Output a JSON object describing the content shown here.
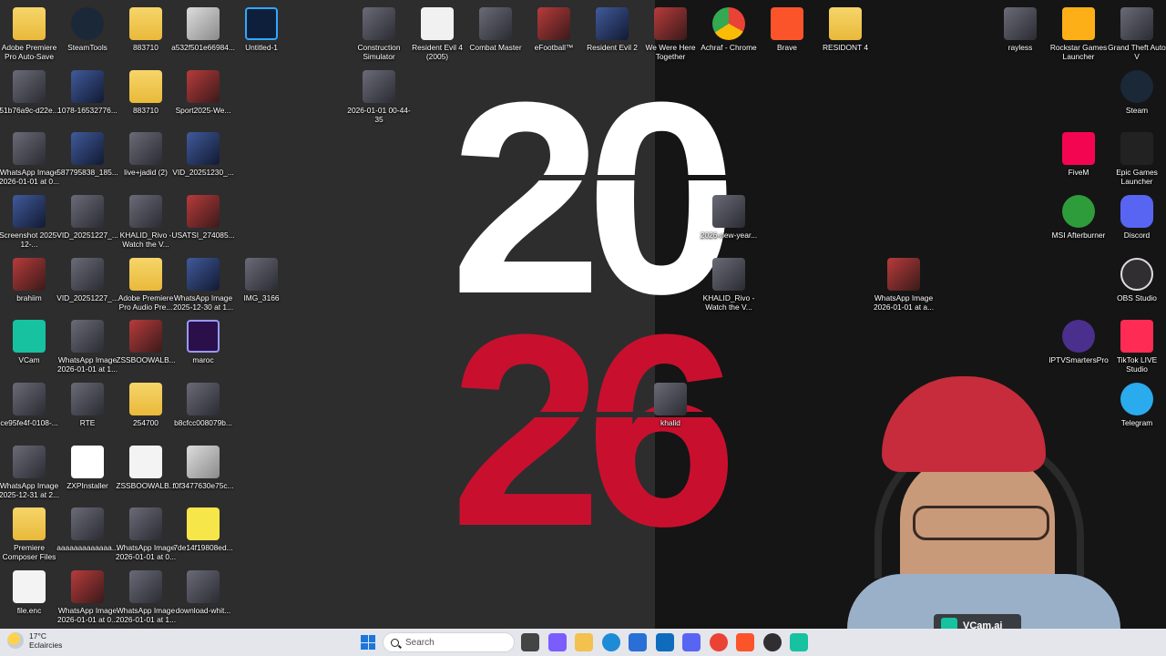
{
  "wallpaper": {
    "top": "20",
    "bottom": "26"
  },
  "desktop_icons": [
    {
      "id": "i1",
      "label": "Adobe Premiere Pro Auto-Save",
      "kind": "folder"
    },
    {
      "id": "i2",
      "label": "SteamTools",
      "kind": "steamtools"
    },
    {
      "id": "i3",
      "label": "883710",
      "kind": "folder"
    },
    {
      "id": "i4",
      "label": "a532f501e66984...",
      "kind": "thumb-light"
    },
    {
      "id": "i5",
      "label": "Untitled-1",
      "kind": "psd"
    },
    {
      "id": "i6",
      "label": "Construction Simulator",
      "kind": "thumb"
    },
    {
      "id": "i7",
      "label": "Resident Evil 4 (2005)",
      "kind": "re4"
    },
    {
      "id": "i8",
      "label": "Combat Master",
      "kind": "thumb"
    },
    {
      "id": "i9",
      "label": "eFootball™",
      "kind": "thumb-red"
    },
    {
      "id": "i10",
      "label": "Resident Evil 2",
      "kind": "thumb-blue"
    },
    {
      "id": "i11",
      "label": "We Were Here Together",
      "kind": "thumb-red"
    },
    {
      "id": "i12",
      "label": "Achraf - Chrome",
      "kind": "chrome"
    },
    {
      "id": "i13",
      "label": "Brave",
      "kind": "brave"
    },
    {
      "id": "i14",
      "label": "RESIDONT 4",
      "kind": "folder"
    },
    {
      "id": "i15",
      "label": "rayless",
      "kind": "thumb"
    },
    {
      "id": "i16",
      "label": "Rockstar Games Launcher",
      "kind": "rockstar"
    },
    {
      "id": "i17",
      "label": "Grand Theft Auto V",
      "kind": "thumb"
    },
    {
      "id": "i18",
      "label": "51b76a9c-d22e...",
      "kind": "thumb"
    },
    {
      "id": "i19",
      "label": "1078-16532776...",
      "kind": "thumb-blue"
    },
    {
      "id": "i20",
      "label": "883710",
      "kind": "folder"
    },
    {
      "id": "i21",
      "label": "Sport2025-We...",
      "kind": "thumb-red"
    },
    {
      "id": "i22",
      "label": "2026-01-01 00-44-35",
      "kind": "thumb"
    },
    {
      "id": "i23",
      "label": "Steam",
      "kind": "steam"
    },
    {
      "id": "i24",
      "label": "WhatsApp Image 2026-01-01 at 0...",
      "kind": "thumb"
    },
    {
      "id": "i25",
      "label": "587795838_185...",
      "kind": "thumb-blue"
    },
    {
      "id": "i26",
      "label": "live+jadid (2)",
      "kind": "thumb"
    },
    {
      "id": "i27",
      "label": "VID_20251230_...",
      "kind": "thumb-blue"
    },
    {
      "id": "i28",
      "label": "FiveM",
      "kind": "fivem"
    },
    {
      "id": "i29",
      "label": "Epic Games Launcher",
      "kind": "epic"
    },
    {
      "id": "i30",
      "label": "Screenshot 2025-12-...",
      "kind": "thumb-blue"
    },
    {
      "id": "i31",
      "label": "VID_20251227_...",
      "kind": "thumb"
    },
    {
      "id": "i32",
      "label": "KHALID_Rivo - Watch the V...",
      "kind": "thumb"
    },
    {
      "id": "i33",
      "label": "USATSI_274085...",
      "kind": "thumb-red"
    },
    {
      "id": "i34",
      "label": "2026-new-year...",
      "kind": "thumb"
    },
    {
      "id": "i35",
      "label": "MSI Afterburner",
      "kind": "msi"
    },
    {
      "id": "i36",
      "label": "Discord",
      "kind": "discord"
    },
    {
      "id": "i37",
      "label": "brahiim",
      "kind": "thumb-red"
    },
    {
      "id": "i38",
      "label": "VID_20251227_...",
      "kind": "thumb"
    },
    {
      "id": "i39",
      "label": "Adobe Premiere Pro Audio Pre...",
      "kind": "folder"
    },
    {
      "id": "i40",
      "label": "WhatsApp Image 2025-12-30 at 1...",
      "kind": "thumb-blue"
    },
    {
      "id": "i41",
      "label": "IMG_3166",
      "kind": "thumb"
    },
    {
      "id": "i42",
      "label": "KHALID_Rivo - Watch the V...",
      "kind": "thumb"
    },
    {
      "id": "i43",
      "label": "WhatsApp Image 2026-01-01 at a...",
      "kind": "thumb-red"
    },
    {
      "id": "i44",
      "label": "OBS Studio",
      "kind": "obs"
    },
    {
      "id": "i45",
      "label": "VCam",
      "kind": "vcam"
    },
    {
      "id": "i46",
      "label": "WhatsApp Image 2026-01-01 at 1...",
      "kind": "thumb"
    },
    {
      "id": "i47",
      "label": "ZSSBOOWALB...",
      "kind": "thumb-red"
    },
    {
      "id": "i48",
      "label": "maroc",
      "kind": "premiere"
    },
    {
      "id": "i49",
      "label": "IPTVSmartersPro",
      "kind": "iptv"
    },
    {
      "id": "i50",
      "label": "TikTok LIVE Studio",
      "kind": "tiktok"
    },
    {
      "id": "i51",
      "label": "ce95fe4f-0108-...",
      "kind": "thumb"
    },
    {
      "id": "i52",
      "label": "RTE",
      "kind": "thumb"
    },
    {
      "id": "i53",
      "label": "254700",
      "kind": "folder"
    },
    {
      "id": "i54",
      "label": "b8cfcc008079b...",
      "kind": "thumb"
    },
    {
      "id": "i55",
      "label": "khalid",
      "kind": "thumb"
    },
    {
      "id": "i56",
      "label": "Telegram",
      "kind": "telegram"
    },
    {
      "id": "i57",
      "label": "WhatsApp Image 2025-12-31 at 2...",
      "kind": "thumb"
    },
    {
      "id": "i58",
      "label": "ZXPInstaller",
      "kind": "zxp"
    },
    {
      "id": "i59",
      "label": "ZSSBOOWALB...",
      "kind": "doc"
    },
    {
      "id": "i60",
      "label": "f0f3477630e75c...",
      "kind": "thumb-light"
    },
    {
      "id": "i61",
      "label": "Premiere Composer Files",
      "kind": "folder"
    },
    {
      "id": "i62",
      "label": "aaaaaaaaaaaaa...",
      "kind": "thumb"
    },
    {
      "id": "i63",
      "label": "WhatsApp Image 2026-01-01 at 0...",
      "kind": "thumb"
    },
    {
      "id": "i64",
      "label": "7de14f19808ed...",
      "kind": "yellow"
    },
    {
      "id": "i65",
      "label": "file.enc",
      "kind": "doc"
    },
    {
      "id": "i66",
      "label": "WhatsApp Image 2026-01-01 at 0...",
      "kind": "thumb-red"
    },
    {
      "id": "i67",
      "label": "WhatsApp Image 2026-01-01 at 1...",
      "kind": "thumb"
    },
    {
      "id": "i68",
      "label": "download-whit...",
      "kind": "thumb"
    }
  ],
  "overlay": {
    "vcam_badge": "VCam.ai"
  },
  "taskbar": {
    "weather_temp": "17°C",
    "weather_desc": "Eclaircies",
    "search_placeholder": "Search",
    "apps": [
      "task-view",
      "copilot",
      "file-explorer",
      "edge",
      "store",
      "outlook",
      "discord",
      "chrome",
      "brave",
      "obs",
      "vcam"
    ]
  },
  "colors": {
    "accent_red": "#c8102e",
    "taskbar": "#e4e6eb"
  }
}
